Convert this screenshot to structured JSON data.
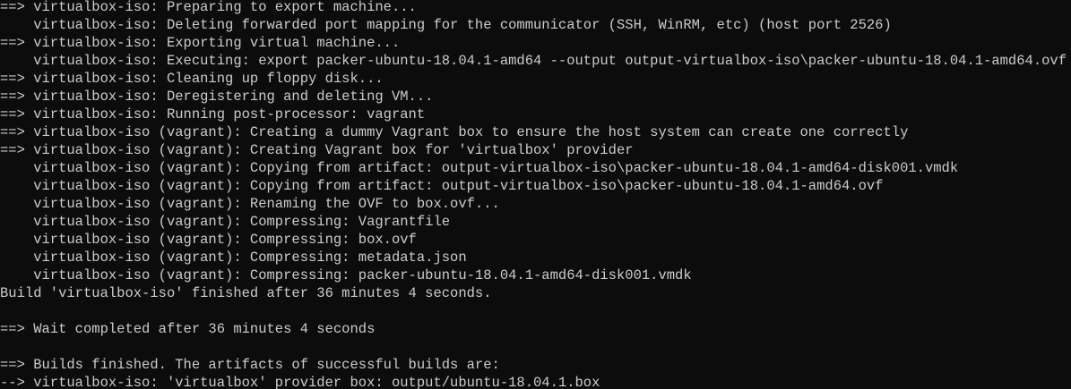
{
  "terminal": {
    "colors": {
      "background": "#0c0c0c",
      "foreground": "#cccccc"
    },
    "lines": [
      "==> virtualbox-iso: Preparing to export machine...",
      "    virtualbox-iso: Deleting forwarded port mapping for the communicator (SSH, WinRM, etc) (host port 2526)",
      "==> virtualbox-iso: Exporting virtual machine...",
      "    virtualbox-iso: Executing: export packer-ubuntu-18.04.1-amd64 --output output-virtualbox-iso\\packer-ubuntu-18.04.1-amd64.ovf",
      "==> virtualbox-iso: Cleaning up floppy disk...",
      "==> virtualbox-iso: Deregistering and deleting VM...",
      "==> virtualbox-iso: Running post-processor: vagrant",
      "==> virtualbox-iso (vagrant): Creating a dummy Vagrant box to ensure the host system can create one correctly",
      "==> virtualbox-iso (vagrant): Creating Vagrant box for 'virtualbox' provider",
      "    virtualbox-iso (vagrant): Copying from artifact: output-virtualbox-iso\\packer-ubuntu-18.04.1-amd64-disk001.vmdk",
      "    virtualbox-iso (vagrant): Copying from artifact: output-virtualbox-iso\\packer-ubuntu-18.04.1-amd64.ovf",
      "    virtualbox-iso (vagrant): Renaming the OVF to box.ovf...",
      "    virtualbox-iso (vagrant): Compressing: Vagrantfile",
      "    virtualbox-iso (vagrant): Compressing: box.ovf",
      "    virtualbox-iso (vagrant): Compressing: metadata.json",
      "    virtualbox-iso (vagrant): Compressing: packer-ubuntu-18.04.1-amd64-disk001.vmdk",
      "Build 'virtualbox-iso' finished after 36 minutes 4 seconds.",
      "",
      "==> Wait completed after 36 minutes 4 seconds",
      "",
      "==> Builds finished. The artifacts of successful builds are:",
      "--> virtualbox-iso: 'virtualbox' provider box: output/ubuntu-18.04.1.box"
    ]
  }
}
